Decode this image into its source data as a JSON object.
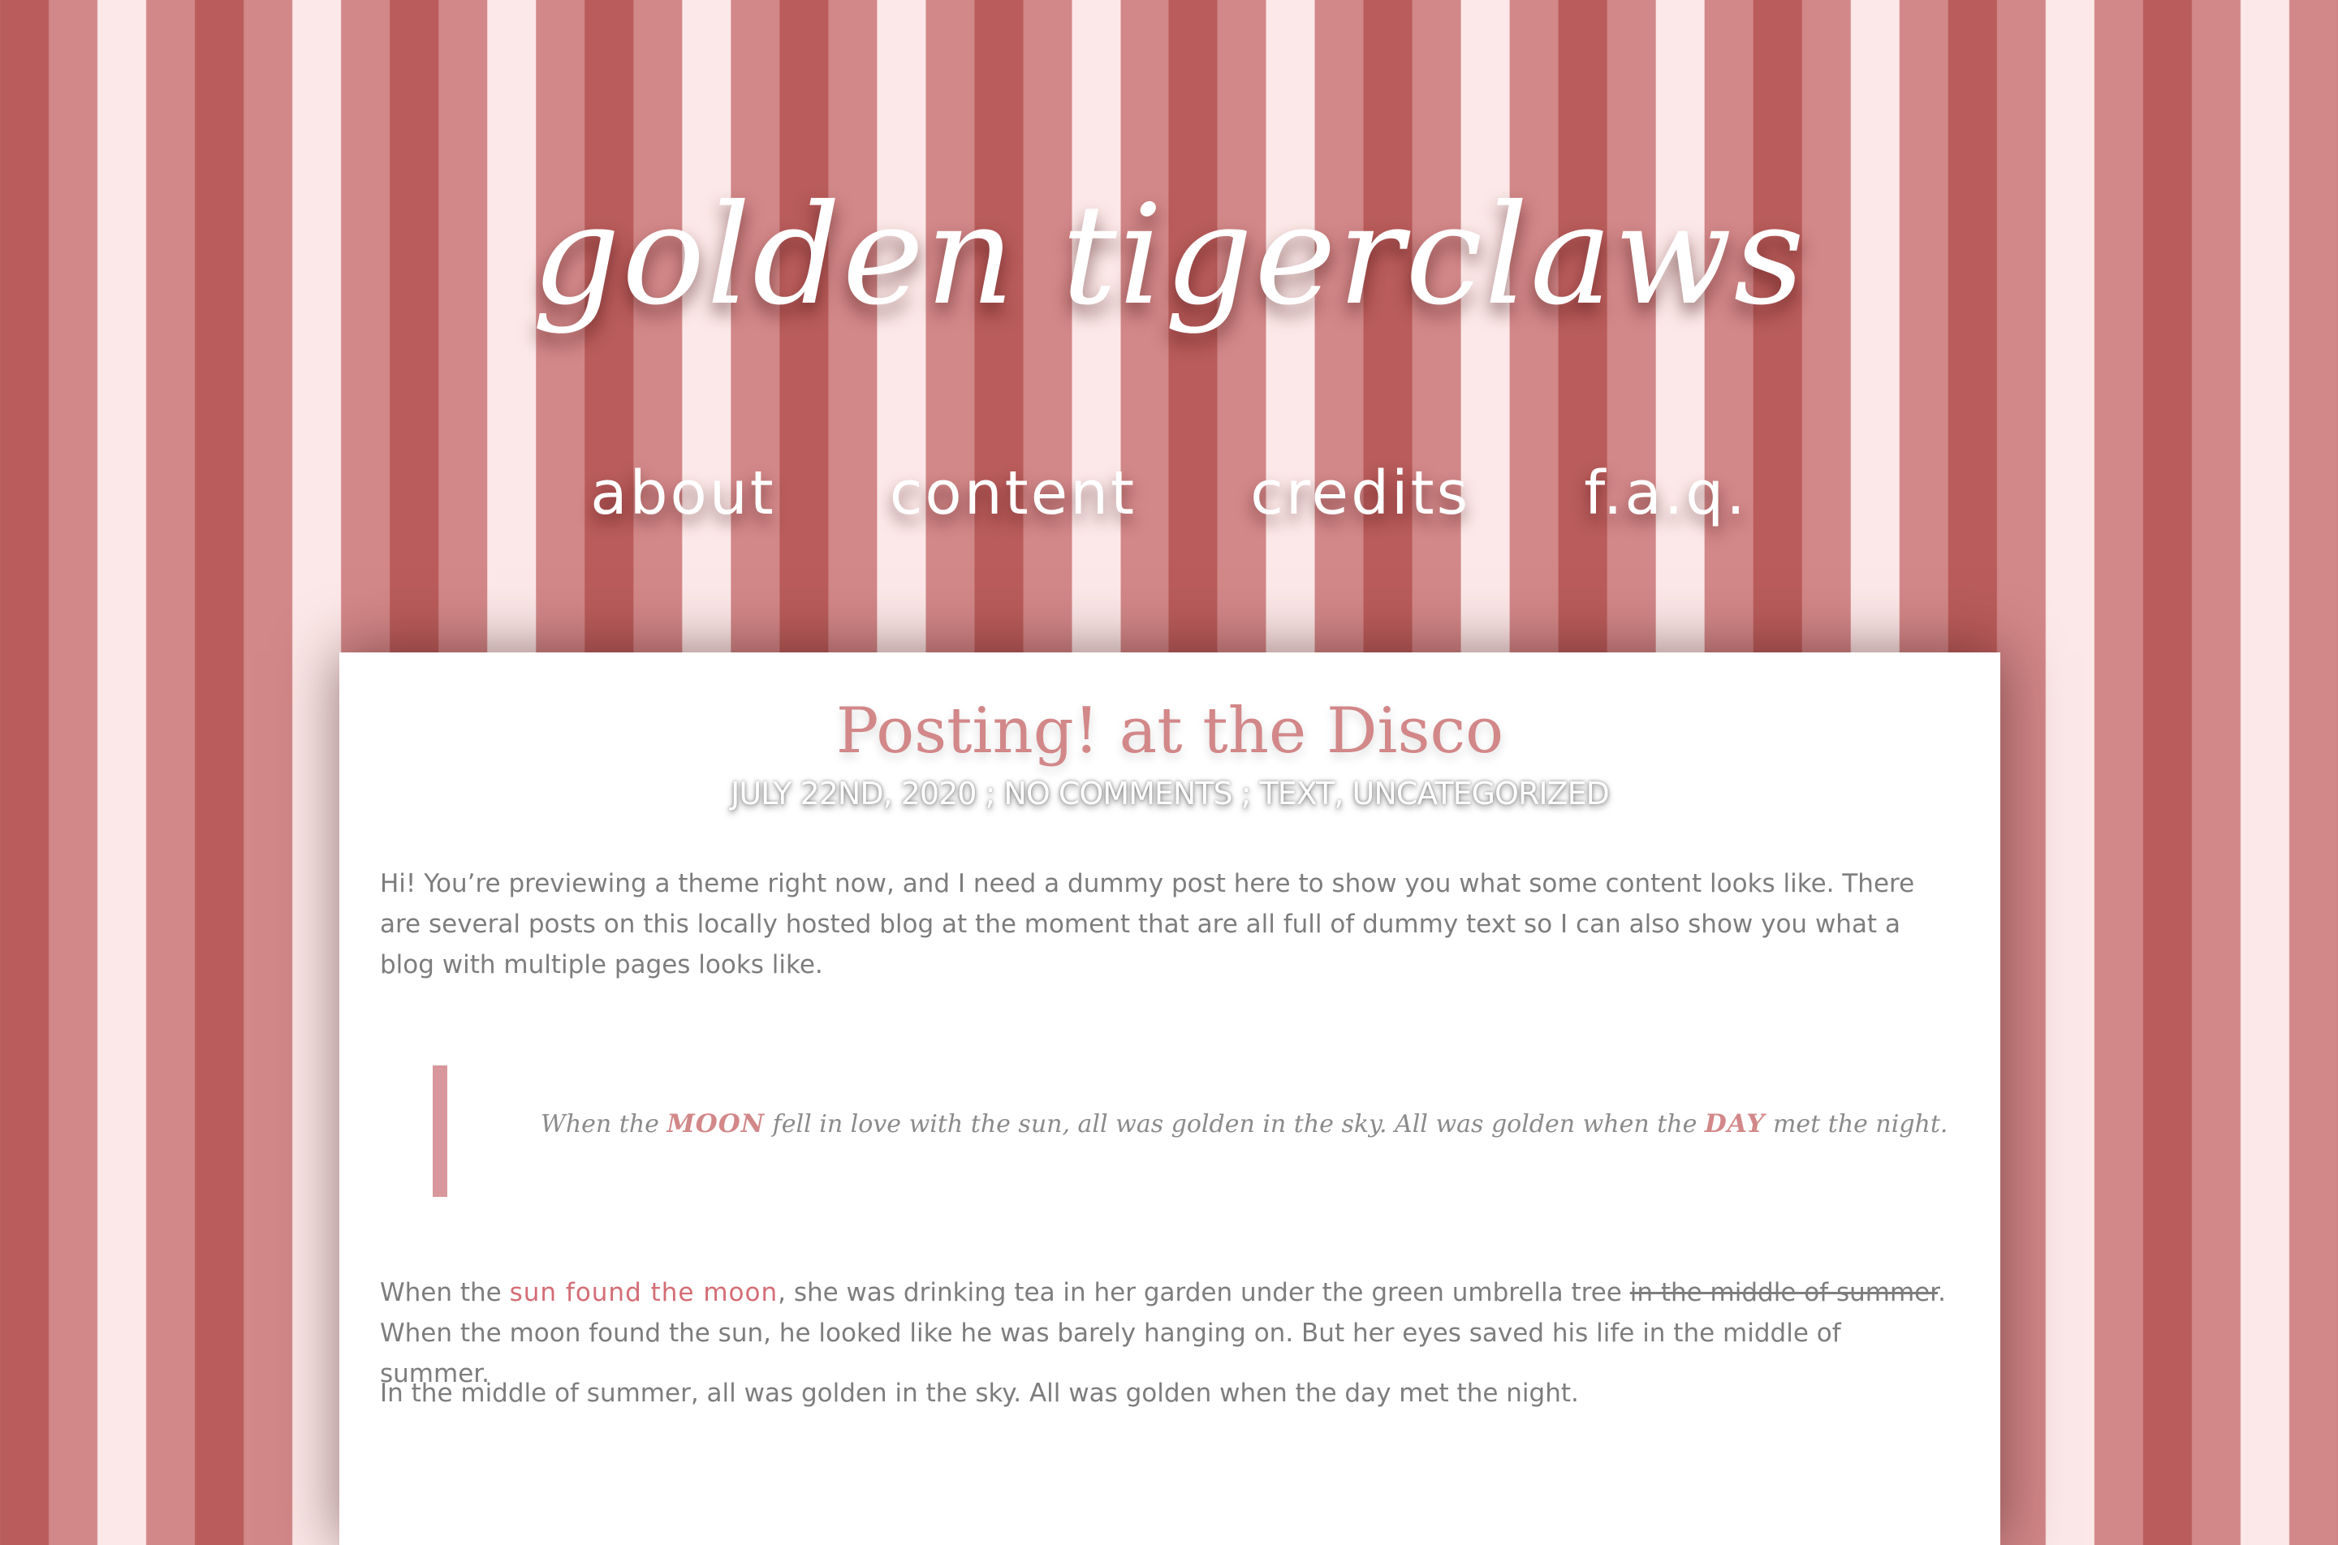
{
  "site": {
    "title": "golden tigerclaws"
  },
  "nav": [
    {
      "label": "about"
    },
    {
      "label": "content"
    },
    {
      "label": "credits"
    },
    {
      "label": "f.a.q."
    }
  ],
  "post": {
    "title": "Posting! at the Disco",
    "meta": "JULY 22ND, 2020 ; NO COMMENTS ; TEXT, UNCATEGORIZED",
    "intro": "Hi! You’re previewing a theme right now, and I need a dummy post here to show you what some content looks like. There are several posts on this locally hosted blog at the moment that are all full of dummy text so I can also show you what a blog with multiple pages looks like.",
    "quote": {
      "part1": "When the ",
      "emph1": "MOON",
      "part2": " fell in love with the sun, all was golden in the sky. All was golden when the ",
      "emph2": "DAY",
      "part3": " met the night."
    },
    "p2": {
      "before": "When the ",
      "link": "sun found the moon",
      "middle": ", she was drinking tea in her garden under the green umbrella tree ",
      "strike": "in the middle of summer",
      "after": ". When the moon found the sun, he looked like he was barely hanging on. But her eyes saved his life in the middle of summer."
    },
    "p3": "In the middle of summer, all was golden in the sky. All was golden when the day met the night."
  },
  "colors": {
    "stripe_dark": "#b95c5b",
    "stripe_mid": "#d28788",
    "stripe_light": "#fce8e8",
    "accent": "#d28788",
    "link": "#d46d75"
  }
}
